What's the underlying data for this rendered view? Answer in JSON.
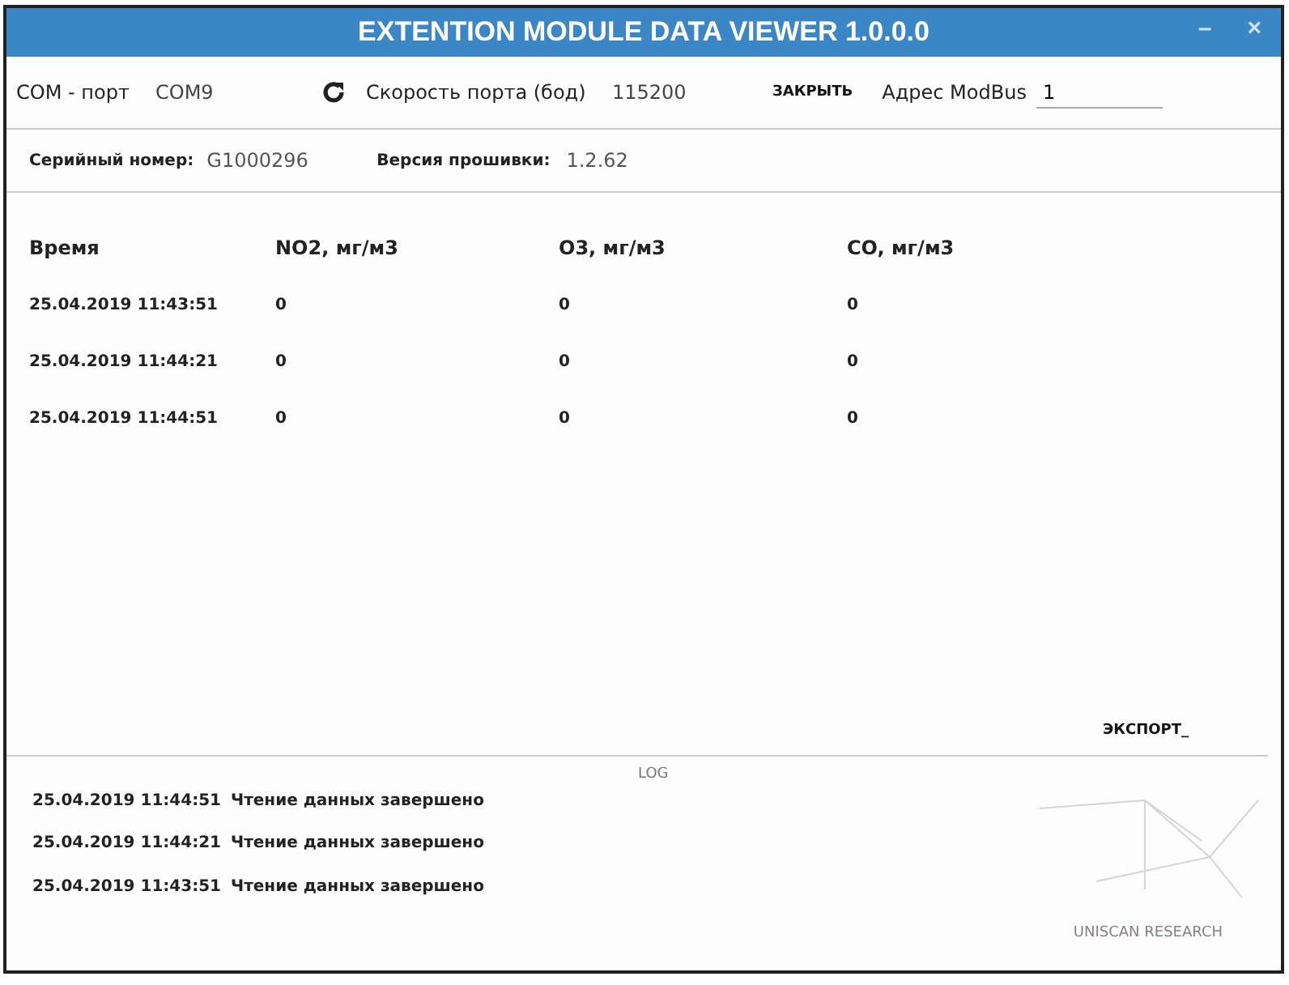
{
  "window": {
    "title": "EXTENTION MODULE DATA VIEWER 1.0.0.0",
    "controls": [
      "–",
      "×"
    ]
  },
  "toolbar": {
    "port_label": "COM - порт",
    "port_value": "COM9",
    "speed_label": "Скорость порта (бод)",
    "speed_value": "115200",
    "close_button": "ЗАКРЫТЬ",
    "address_label": "Адрес ModBus",
    "address_value": "1"
  },
  "info": {
    "serial_label": "Серийный номер:",
    "serial_value": "G1000296",
    "firmware_label": "Версия прошивки:",
    "firmware_value": "1.2.62"
  },
  "table": {
    "columns": [
      "Время",
      "NO2, мг/м3",
      "O3, мг/м3",
      "CO, мг/м3"
    ],
    "rows": [
      [
        "25.04.2019 11:43:51",
        "0",
        "0",
        "0"
      ],
      [
        "25.04.2019 11:44:21",
        "0",
        "0",
        "0"
      ],
      [
        "25.04.2019 11:44:51",
        "0",
        "0",
        "0"
      ]
    ]
  },
  "export_button": "ЭКСПОРТ_",
  "log": {
    "title": "LOG",
    "entries": [
      {
        "time": "25.04.2019 11:44:51",
        "message": "Чтение данных завершено"
      },
      {
        "time": "25.04.2019 11:44:21",
        "message": "Чтение данных завершено"
      },
      {
        "time": "25.04.2019 11:43:51",
        "message": "Чтение данных завершено"
      }
    ]
  },
  "brand": "UNISCAN RESEARCH"
}
